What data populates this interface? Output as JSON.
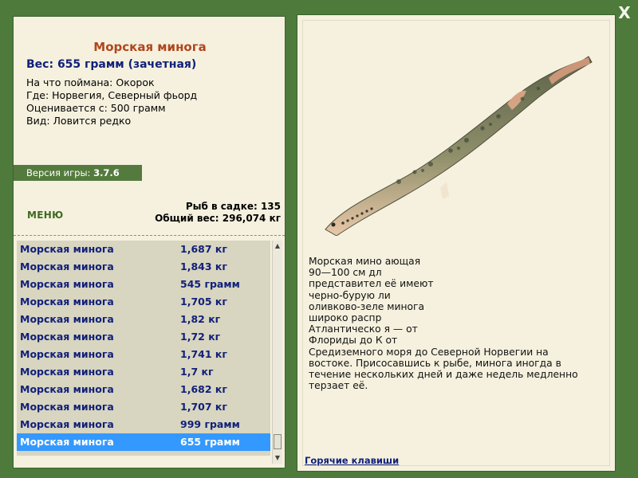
{
  "window": {
    "close_label": "X"
  },
  "fish": {
    "title": "Морская минога",
    "weight": "Вес: 655 грамм (зачетная)",
    "info": [
      "На что поймана: Окорок",
      "Где: Норвегия, Северный фьорд",
      "Оценивается с: 500 грамм",
      "Вид: Ловится редко"
    ]
  },
  "version": {
    "label": "Версия игры: ",
    "value": "3.7.6"
  },
  "menu_label": "МЕНЮ",
  "stats": {
    "count": "Рыб в садке: 135",
    "total": "Общий вес: 296,074 кг"
  },
  "catch_list": [
    {
      "name": "Морская минога",
      "weight": "1,687 кг"
    },
    {
      "name": "Морская минога",
      "weight": "1,843 кг"
    },
    {
      "name": "Морская минога",
      "weight": "545 грамм"
    },
    {
      "name": "Морская минога",
      "weight": "1,705 кг"
    },
    {
      "name": "Морская минога",
      "weight": "1,82 кг"
    },
    {
      "name": "Морская минога",
      "weight": "1,72 кг"
    },
    {
      "name": "Морская минога",
      "weight": "1,741 кг"
    },
    {
      "name": "Морская минога",
      "weight": "1,7 кг"
    },
    {
      "name": "Морская минога",
      "weight": "1,682 кг"
    },
    {
      "name": "Морская минога",
      "weight": "1,707 кг"
    },
    {
      "name": "Морская минога",
      "weight": "999 грамм"
    },
    {
      "name": "Морская минога",
      "weight": "655 грамм",
      "selected": true
    }
  ],
  "description": "Морская мино                                        ающая\n90—100 см дл\nпредставител                                         её имеют\nчерно-бурую                                                  ли\nоливково-зеле                                          минога\nширокo распр\nАтлантическо                                         я — от\nФлориды до К                                           от\nСредиземного моря до Северной Норвегии на\nвостоке. Присосавшись к рыбе, минога иногда в\nтечение нескольких дней и даже недель медленно\nтерзает её.",
  "hotkeys_label": "Горячие клавиши",
  "icons": {
    "close": "close-icon",
    "scroll_up": "arrow-up-icon",
    "scroll_down": "arrow-down-icon"
  },
  "colors": {
    "frame": "#4e7a3c",
    "panel": "#f5f1de",
    "title": "#b0461e",
    "link": "#11207a",
    "selection": "#3399ff"
  }
}
